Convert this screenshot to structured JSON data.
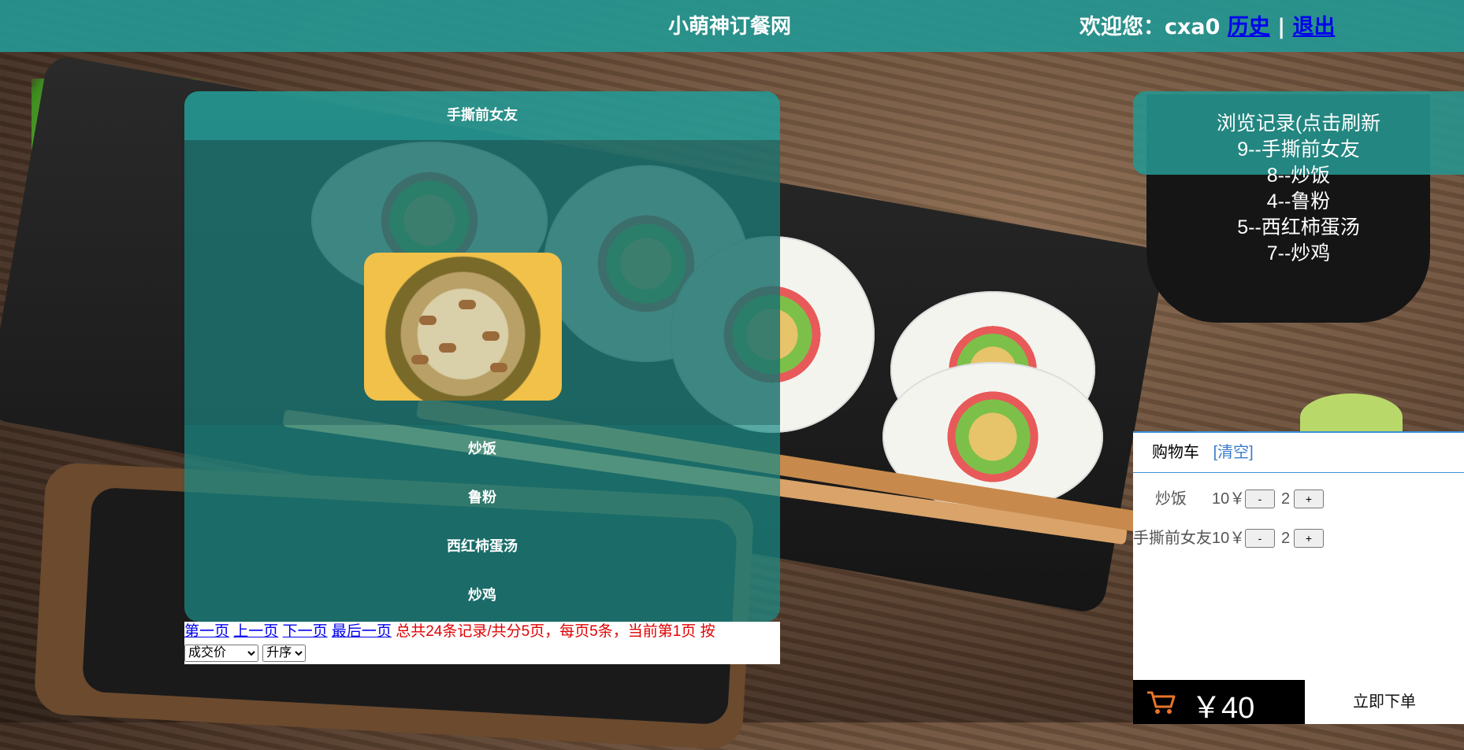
{
  "header": {
    "site_title": "小萌神订餐网",
    "welcome_prefix": "欢迎您：cxa0",
    "history_link": "历史",
    "separator": "|",
    "logout_link": "退出"
  },
  "menu": {
    "expanded_item": "手撕前女友",
    "items": [
      "炒饭",
      "鲁粉",
      "西红柿蛋汤",
      "炒鸡"
    ]
  },
  "pager": {
    "first": "第一页",
    "prev": "上一页",
    "next": "下一页",
    "last": "最后一页",
    "info": "总共24条记录/共分5页，每页5条，当前第1页 按",
    "sort_field": "成交价",
    "sort_order": "升序"
  },
  "history": {
    "title": "浏览记录(点击刷新",
    "entries": [
      "9--手撕前女友",
      "8--炒饭",
      "4--鲁粉",
      "5--西红柿蛋汤",
      "7--炒鸡"
    ]
  },
  "cart": {
    "title": "购物车",
    "clear": "[清空]",
    "rows": [
      {
        "name": "炒饭",
        "price": "10￥",
        "minus": "-",
        "qty": "2",
        "plus": "+"
      },
      {
        "name": "手撕前女友",
        "price": "10￥",
        "minus": "-",
        "qty": "2",
        "plus": "+"
      }
    ],
    "total": "￥40",
    "order": "立即下单"
  },
  "colors": {
    "header_bg": "#269691",
    "link": "#0000ee",
    "pager_info": "#e00000",
    "cart_accent": "#3a8fd8"
  }
}
